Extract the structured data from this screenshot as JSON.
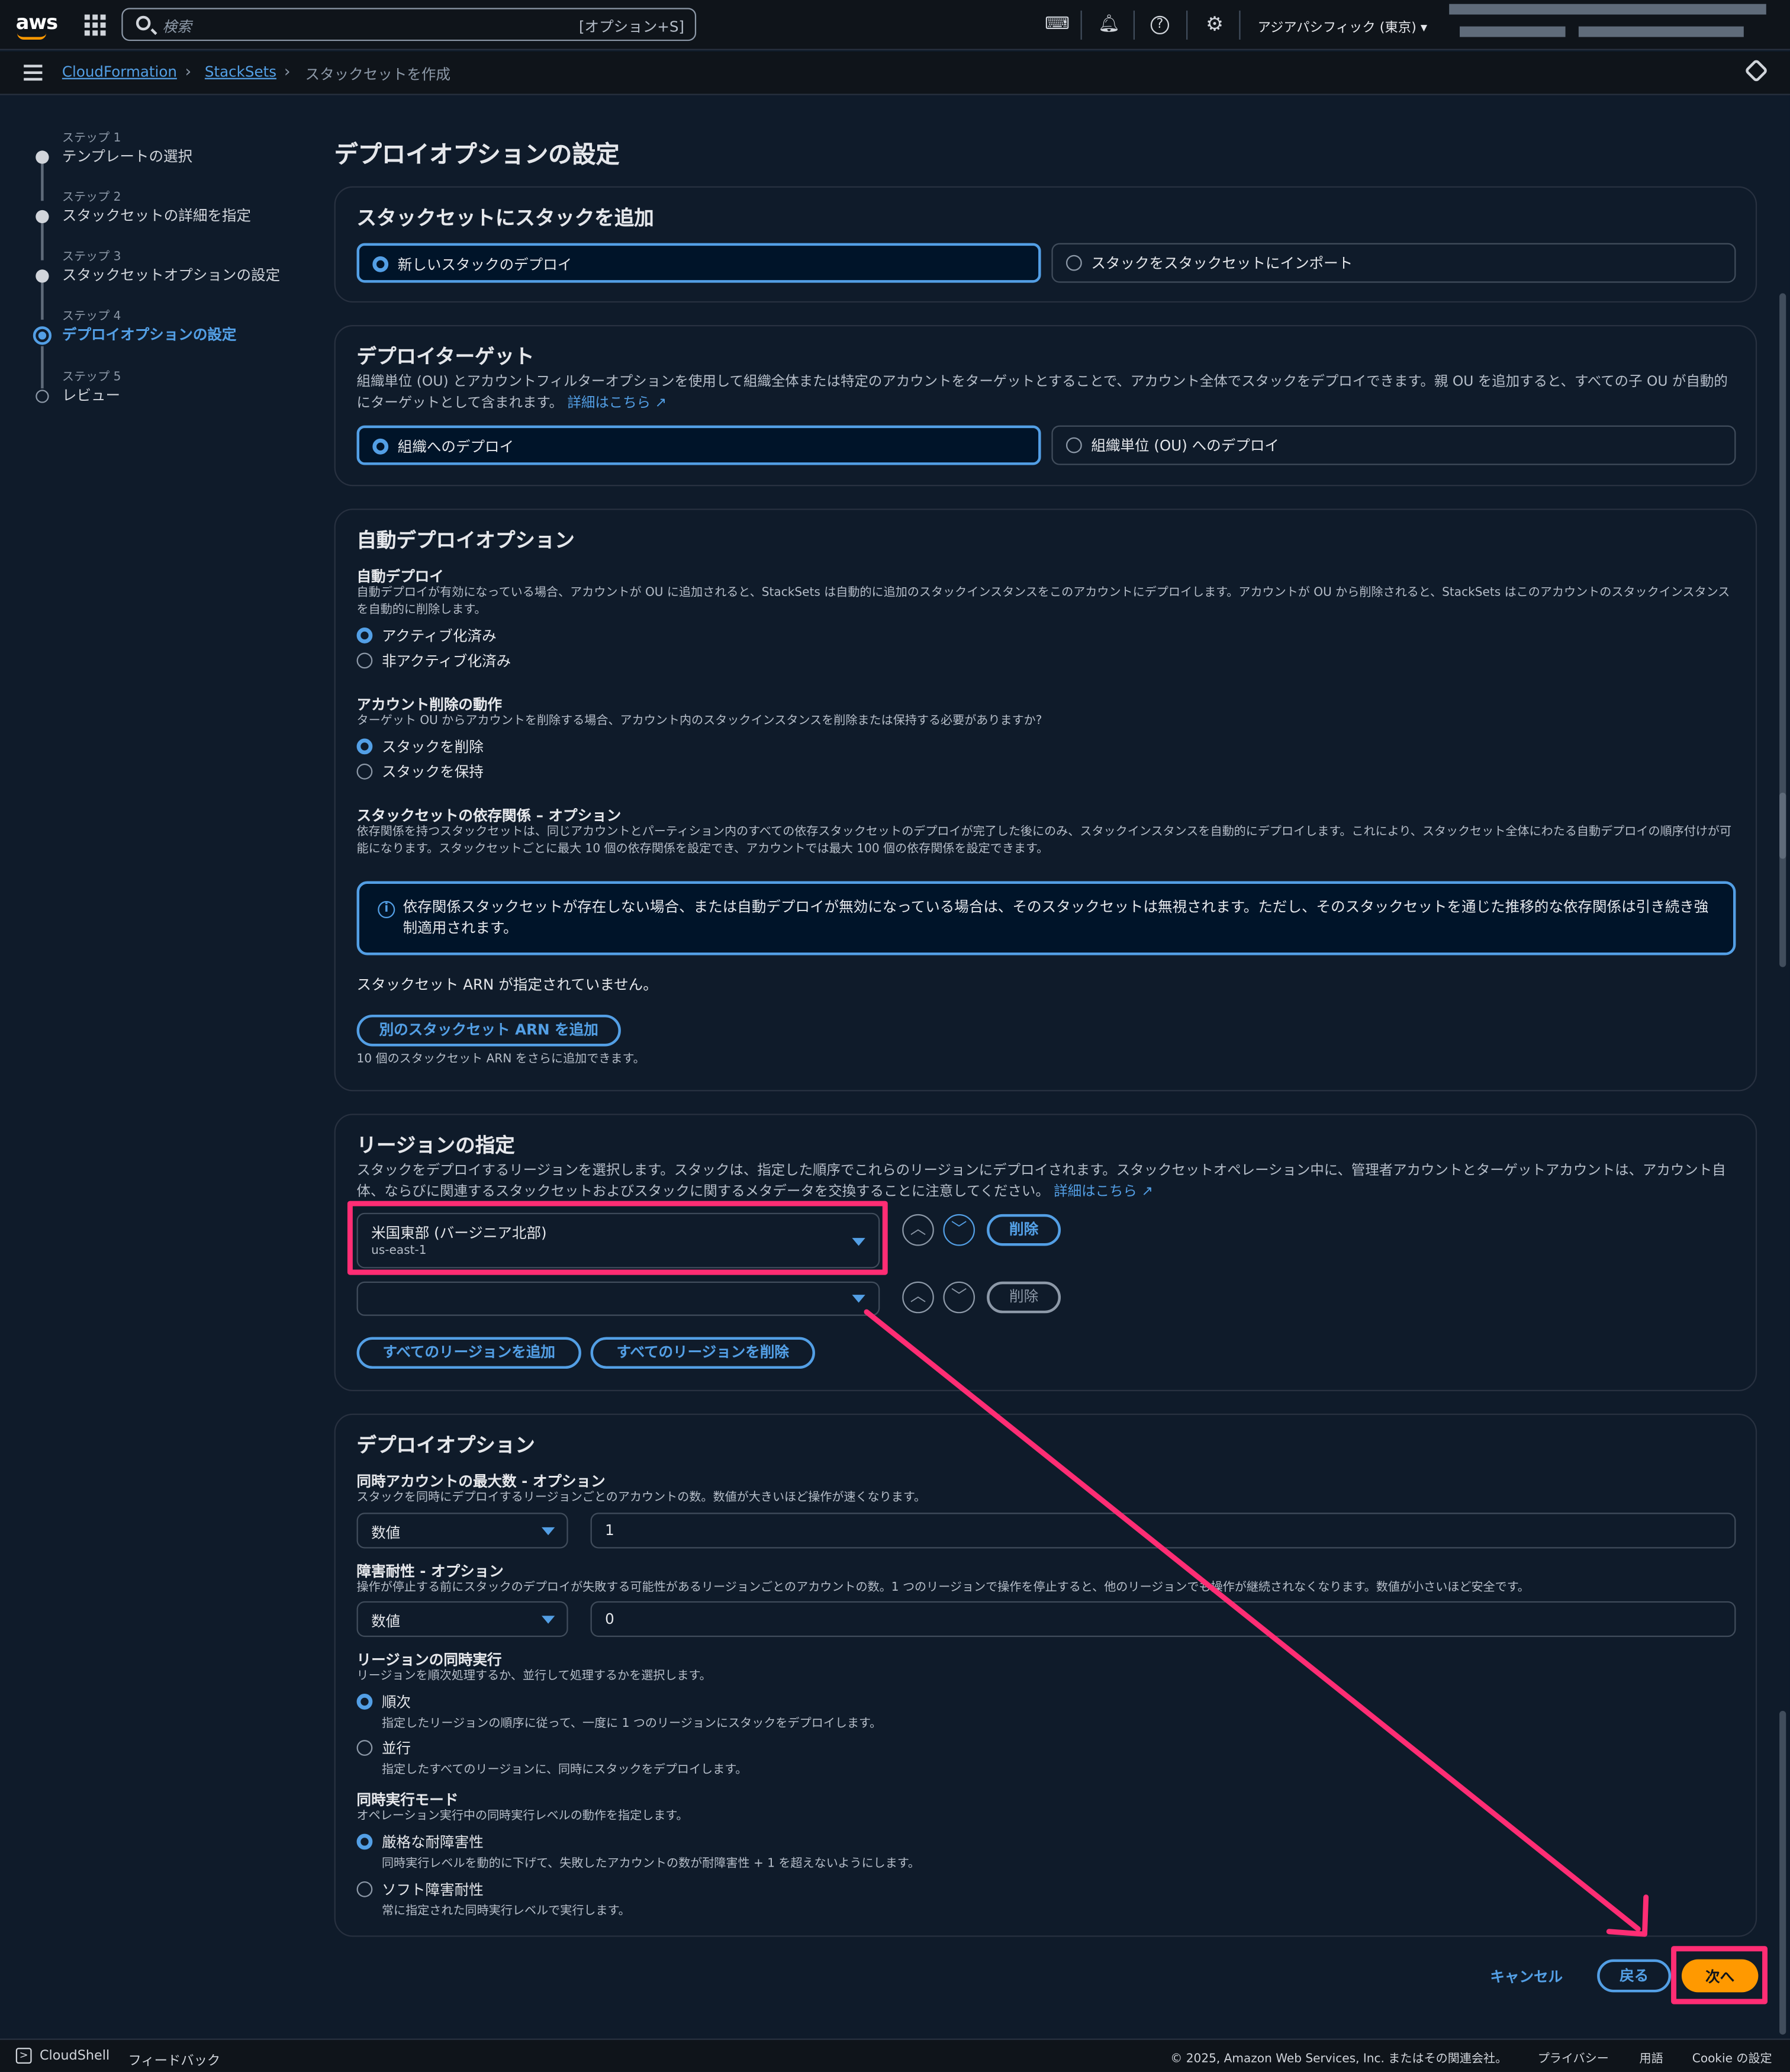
{
  "topbar": {
    "logo": "aws",
    "search_placeholder": "検索",
    "search_shortcut": "[オプション+S]",
    "region": "アジアパシフィック (東京)"
  },
  "breadcrumb": {
    "items": [
      "CloudFormation",
      "StackSets",
      "スタックセットを作成"
    ]
  },
  "steps": [
    {
      "small": "ステップ 1",
      "label": "テンプレートの選択"
    },
    {
      "small": "ステップ 2",
      "label": "スタックセットの詳細を指定"
    },
    {
      "small": "ステップ 3",
      "label": "スタックセットオプションの設定"
    },
    {
      "small": "ステップ 4",
      "label": "デプロイオプションの設定"
    },
    {
      "small": "ステップ 5",
      "label": "レビュー"
    }
  ],
  "page_title": "デプロイオプションの設定",
  "add_stacks": {
    "title": "スタックセットにスタックを追加",
    "opt1": "新しいスタックのデプロイ",
    "opt2": "スタックをスタックセットにインポート"
  },
  "target": {
    "title": "デプロイターゲット",
    "desc": "組織単位 (OU) とアカウントフィルターオプションを使用して組織全体または特定のアカウントをターゲットとすることで、アカウント全体でスタックをデプロイできます。親 OU を追加すると、すべての子 OU が自動的にターゲットとして含まれます。",
    "link": "詳細はこちら",
    "opt1": "組織へのデプロイ",
    "opt2": "組織単位 (OU) へのデプロイ"
  },
  "auto": {
    "title": "自動デプロイオプション",
    "deploy_label": "自動デプロイ",
    "deploy_desc": "自動デプロイが有効になっている場合、アカウントが OU に追加されると、StackSets は自動的に追加のスタックインスタンスをこのアカウントにデプロイします。アカウントが OU から削除されると、StackSets はこのアカウントのスタックインスタンスを自動的に削除します。",
    "on": "アクティブ化済み",
    "off": "非アクティブ化済み",
    "removal_label": "アカウント削除の動作",
    "removal_desc": "ターゲット OU からアカウントを削除する場合、アカウント内のスタックインスタンスを削除または保持する必要がありますか?",
    "delete": "スタックを削除",
    "retain": "スタックを保持",
    "dep_label": "スタックセットの依存関係 – オプション",
    "dep_desc": "依存関係を持つスタックセットは、同じアカウントとパーティション内のすべての依存スタックセットのデプロイが完了した後にのみ、スタックインスタンスを自動的にデプロイします。これにより、スタックセット全体にわたる自動デプロイの順序付けが可能になります。スタックセットごとに最大 10 個の依存関係を設定でき、アカウントでは最大 100 個の依存関係を設定できます。",
    "info": "依存関係スタックセットが存在しない場合、または自動デプロイが無効になっている場合は、そのスタックセットは無視されます。ただし、そのスタックセットを通じた推移的な依存関係は引き続き強制適用されます。",
    "no_arn": "スタックセット ARN が指定されていません。",
    "add_arn": "別のスタックセット ARN を追加",
    "arn_hint": "10 個のスタックセット ARN をさらに追加できます。"
  },
  "regions": {
    "title": "リージョンの指定",
    "desc": "スタックをデプロイするリージョンを選択します。スタックは、指定した順序でこれらのリージョンにデプロイされます。スタックセットオペレーション中に、管理者アカウントとターゲットアカウントは、アカウント自体、ならびに関連するスタックセットおよびスタックに関するメタデータを交換することに注意してください。",
    "link": "詳細はこちら",
    "selected_name": "米国東部 (バージニア北部)",
    "selected_code": "us-east-1",
    "remove": "削除",
    "add_all": "すべてのリージョンを追加",
    "remove_all": "すべてのリージョンを削除"
  },
  "deploy": {
    "title": "デプロイオプション",
    "max_label": "同時アカウントの最大数 - オプション",
    "max_desc": "スタックを同時にデプロイするリージョンごとのアカウントの数。数値が大きいほど操作が速くなります。",
    "max_type": "数値",
    "max_value": "1",
    "ft_label": "障害耐性 - オプション",
    "ft_desc": "操作が停止する前にスタックのデプロイが失敗する可能性があるリージョンごとのアカウントの数。1 つのリージョンで操作を停止すると、他のリージョンでも操作が継続されなくなります。数値が小さいほど安全です。",
    "ft_type": "数値",
    "ft_value": "0",
    "rc_label": "リージョンの同時実行",
    "rc_desc": "リージョンを順次処理するか、並行して処理するかを選択します。",
    "seq": "順次",
    "seq_desc": "指定したリージョンの順序に従って、一度に 1 つのリージョンにスタックをデプロイします。",
    "par": "並行",
    "par_desc": "指定したすべてのリージョンに、同時にスタックをデプロイします。",
    "mode_label": "同時実行モード",
    "mode_desc": "オペレーション実行中の同時実行レベルの動作を指定します。",
    "strict": "厳格な耐障害性",
    "strict_desc": "同時実行レベルを動的に下げて、失敗したアカウントの数が耐障害性 + 1 を超えないようにします。",
    "soft": "ソフト障害耐性",
    "soft_desc": "常に指定された同時実行レベルで実行します。"
  },
  "actions": {
    "cancel": "キャンセル",
    "back": "戻る",
    "next": "次へ"
  },
  "footer": {
    "cloudshell": "CloudShell",
    "feedback": "フィードバック",
    "copyright": "© 2025, Amazon Web Services, Inc. またはその関連会社。",
    "privacy": "プライバシー",
    "terms": "用語",
    "cookie": "Cookie の設定"
  },
  "colors": {
    "accent": "#539fe5",
    "primary": "#ff9900",
    "highlight": "#ff2d74",
    "bg": "#0f1b2a"
  }
}
